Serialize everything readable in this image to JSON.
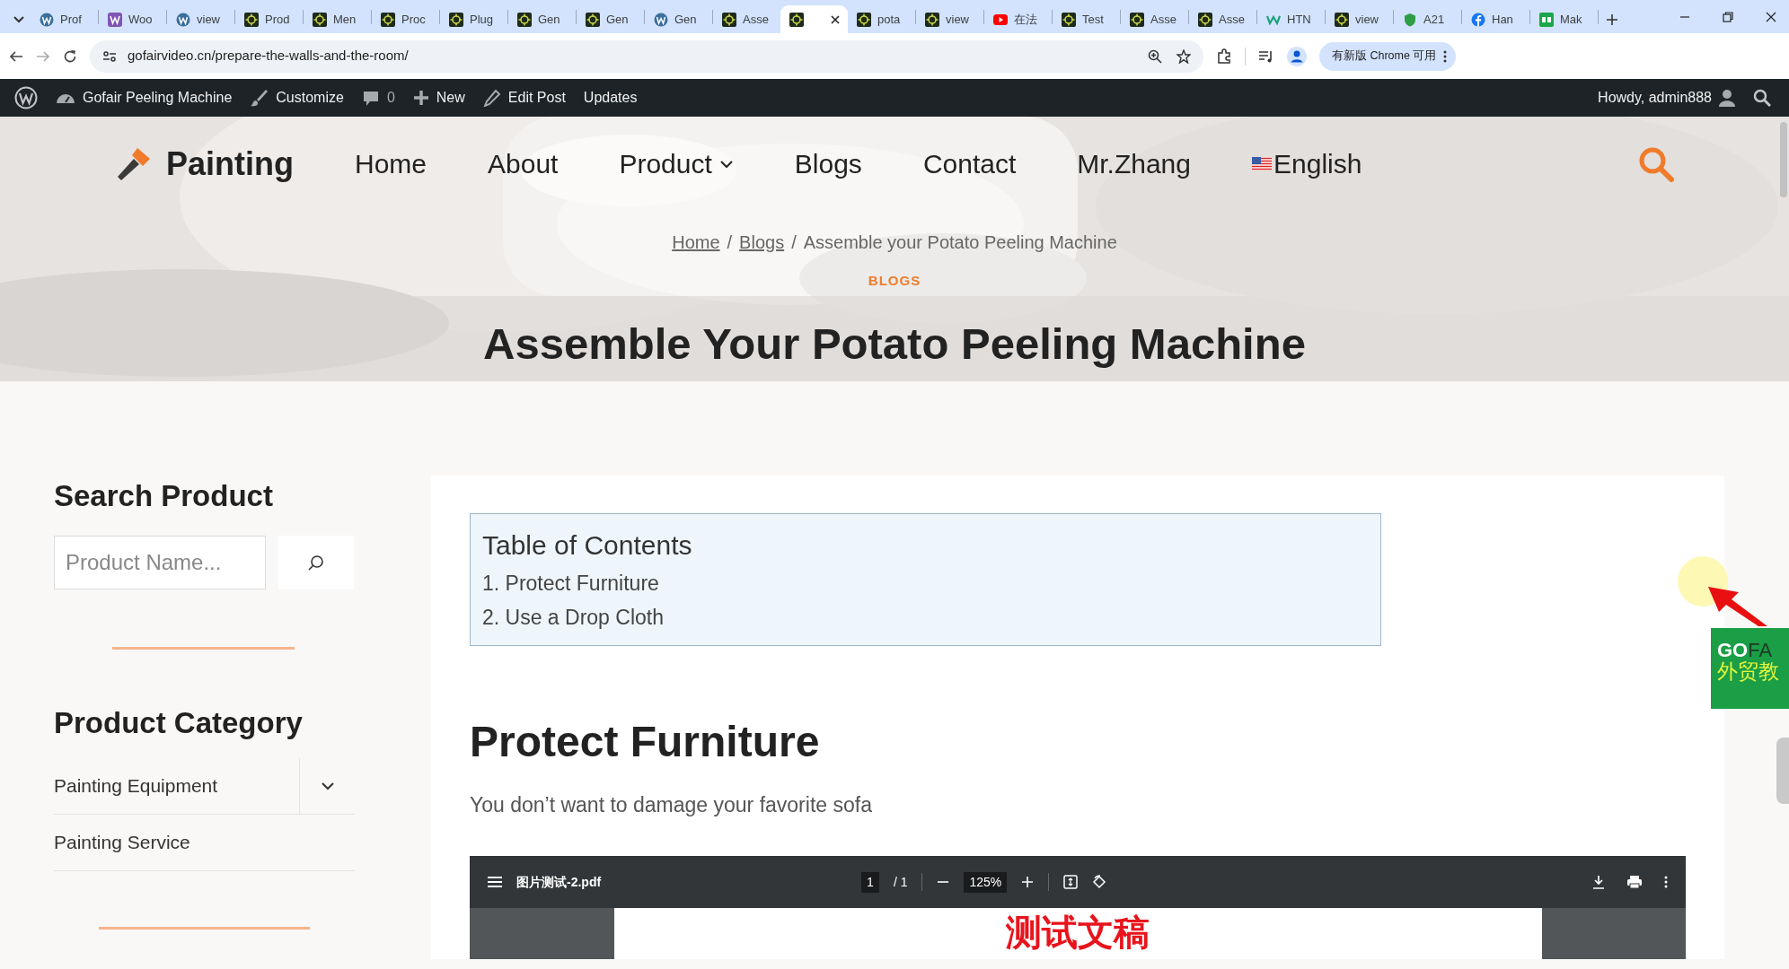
{
  "browser": {
    "tabs": [
      {
        "kind": "wp",
        "label": "Prof",
        "selected": false
      },
      {
        "kind": "woo",
        "label": "Woo",
        "selected": false
      },
      {
        "kind": "wp",
        "label": "view",
        "selected": false
      },
      {
        "kind": "gear",
        "label": "Prod",
        "selected": false
      },
      {
        "kind": "gear",
        "label": "Men",
        "selected": false
      },
      {
        "kind": "gear",
        "label": "Proc",
        "selected": false
      },
      {
        "kind": "gear",
        "label": "Plug",
        "selected": false
      },
      {
        "kind": "gear",
        "label": "Gen",
        "selected": false
      },
      {
        "kind": "gear",
        "label": "Gen",
        "selected": false
      },
      {
        "kind": "wp",
        "label": "Gen",
        "selected": false
      },
      {
        "kind": "gear",
        "label": "Asse",
        "selected": false
      },
      {
        "kind": "gear",
        "selected": true
      },
      {
        "kind": "gear",
        "label": "pota",
        "selected": false
      },
      {
        "kind": "gear",
        "label": "view",
        "selected": false
      },
      {
        "kind": "youtube",
        "label": "在法",
        "selected": false
      },
      {
        "kind": "gear",
        "label": "Test",
        "selected": false
      },
      {
        "kind": "gear",
        "label": "Asse",
        "selected": false
      },
      {
        "kind": "gear",
        "label": "Asse",
        "selected": false
      },
      {
        "kind": "wix",
        "label": "HTN",
        "selected": false
      },
      {
        "kind": "gear",
        "label": "view",
        "selected": false
      },
      {
        "kind": "shield",
        "label": "A21",
        "selected": false
      },
      {
        "kind": "facebook",
        "label": "Han",
        "selected": false
      },
      {
        "kind": "go",
        "label": "Mak",
        "selected": false
      }
    ],
    "address": "gofairvideo.cn/prepare-the-walls-and-the-room/",
    "update_button": "有新版 Chrome 可用"
  },
  "admin_bar": {
    "items": [
      {
        "kind": "site",
        "label": "Gofair Peeling Machine"
      },
      {
        "kind": "customize",
        "label": "Customize"
      },
      {
        "kind": "comments",
        "label": "0"
      },
      {
        "kind": "new",
        "label": "New"
      },
      {
        "kind": "edit",
        "label": "Edit Post"
      },
      {
        "kind": "plain",
        "label": "Updates"
      }
    ],
    "greeting": "Howdy, admin888"
  },
  "site_nav": {
    "logo": "Painting",
    "items": [
      {
        "kind": "link",
        "label": "Home"
      },
      {
        "kind": "link",
        "label": "About"
      },
      {
        "kind": "dropdown",
        "label": "Product"
      },
      {
        "kind": "link",
        "label": "Blogs"
      },
      {
        "kind": "link",
        "label": "Contact"
      },
      {
        "kind": "link",
        "label": "Mr.Zhang"
      },
      {
        "kind": "language",
        "label": "English"
      }
    ]
  },
  "hero": {
    "separator": "/",
    "breadcrumb": [
      {
        "label": "Home",
        "link": true
      },
      {
        "label": "Blogs",
        "link": true
      },
      {
        "label": "Assemble your Potato Peeling Machine",
        "link": false
      }
    ],
    "category": "BLOGS",
    "title": "Assemble Your Potato Peeling Machine"
  },
  "sidebar": {
    "search_title": "Search Product",
    "search_placeholder": "Product Name...",
    "category_title": "Product Category",
    "categories": [
      {
        "label": "Painting Equipment",
        "kind": "expandable"
      },
      {
        "label": "Painting Service",
        "kind": "plain"
      }
    ]
  },
  "article": {
    "toc": {
      "title": "Table of Contents",
      "items": [
        "1. Protect Furniture",
        "2. Use a Drop Cloth"
      ]
    },
    "heading": "Protect Furniture",
    "paragraph": "You don’t want to damage your favorite sofa",
    "pdf_viewer": {
      "file": "图片测试-2.pdf",
      "page": "1",
      "pages": "/ 1",
      "zoom": "125%",
      "page_text": "测试文稿"
    }
  },
  "floating_ad": {
    "text_1": "GO",
    "text_2": "FA",
    "text_3": "外贸教"
  }
}
